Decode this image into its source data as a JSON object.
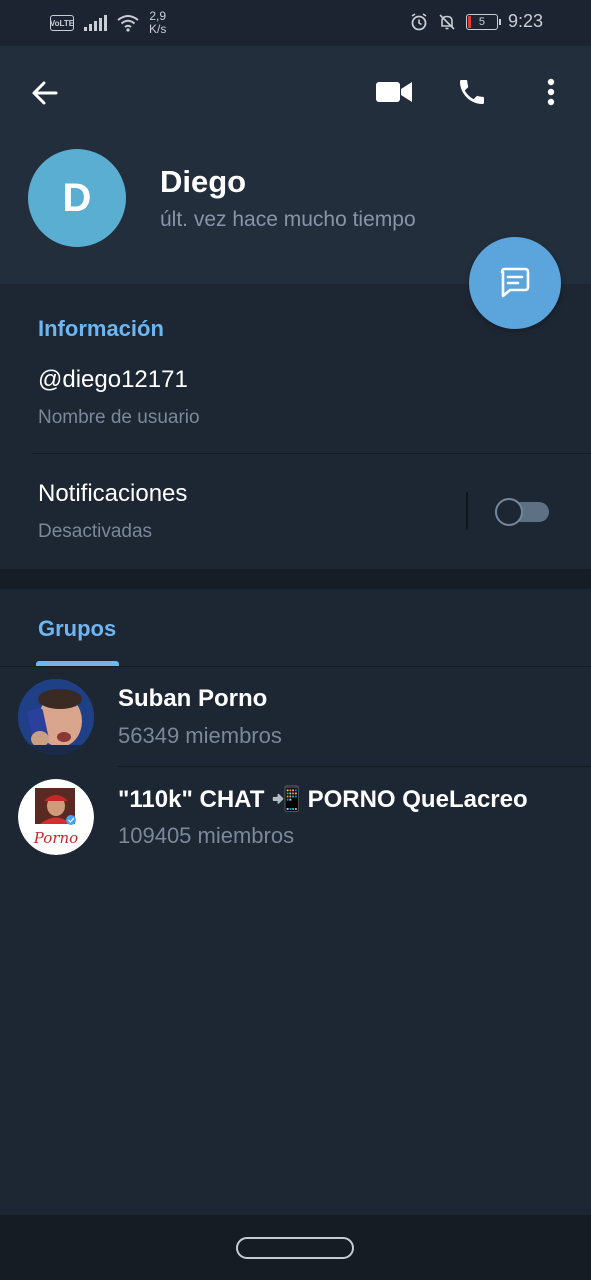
{
  "status_bar": {
    "volte": "VoLTE",
    "speed_value": "2,9",
    "speed_unit": "K/s",
    "battery_level": "5",
    "time": "9:23"
  },
  "header": {
    "avatar_letter": "D",
    "name": "Diego",
    "last_seen": "últ. vez hace mucho tiempo",
    "avatar_color": "#5aaed1"
  },
  "info": {
    "section_title": "Información",
    "username": "@diego12171",
    "username_label": "Nombre de usuario",
    "notifications_title": "Notificaciones",
    "notifications_status": "Desactivadas",
    "notifications_enabled": false
  },
  "groups": {
    "tab_label": "Grupos",
    "items": [
      {
        "name": "Suban Porno",
        "members": "56349 miembros"
      },
      {
        "name": "\"110k\" CHAT 📲 PORNO QueLacreo",
        "members": "109405 miembros",
        "avatar_caption": "Porno"
      }
    ]
  },
  "colors": {
    "accent": "#6fb5ef",
    "background": "#1d2733",
    "header": "#222e3c",
    "fab": "#5ba4dc"
  }
}
